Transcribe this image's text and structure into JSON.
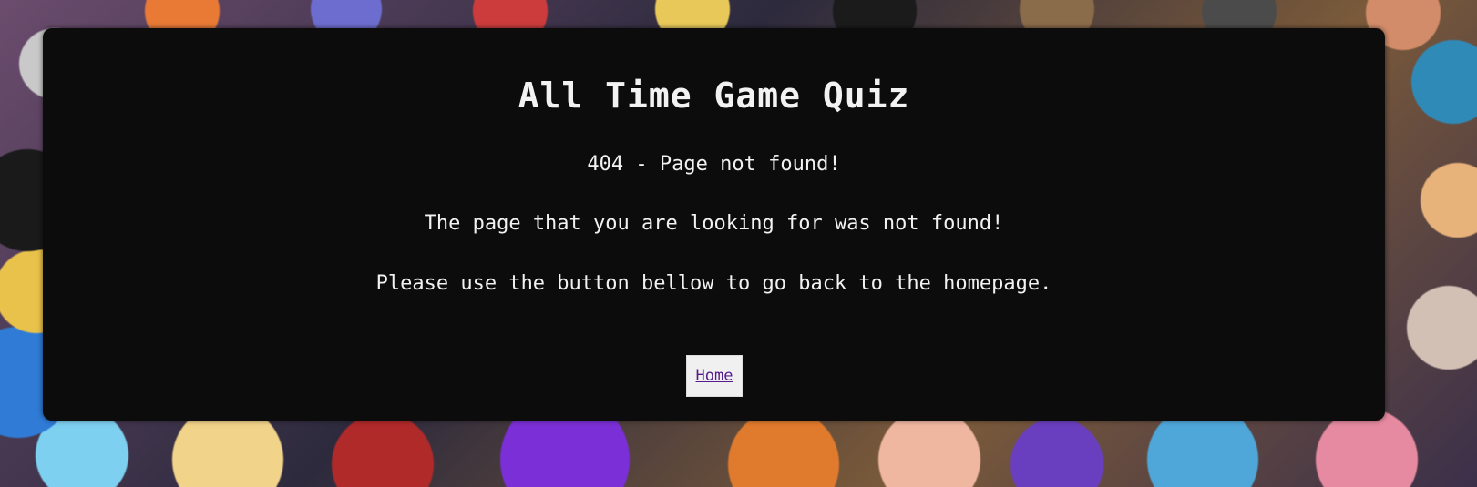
{
  "header": {
    "title": "All Time Game Quiz"
  },
  "error": {
    "code_line": "404 - Page not found!",
    "description": "The page that you are looking for was not found!",
    "instruction": "Please use the button bellow to go back to the homepage."
  },
  "actions": {
    "home_label": "Home"
  },
  "colors": {
    "panel_background": "#0c0c0c",
    "text": "#f2f2f2",
    "button_background": "#f0f0f0",
    "link_visited": "#551a8b"
  }
}
